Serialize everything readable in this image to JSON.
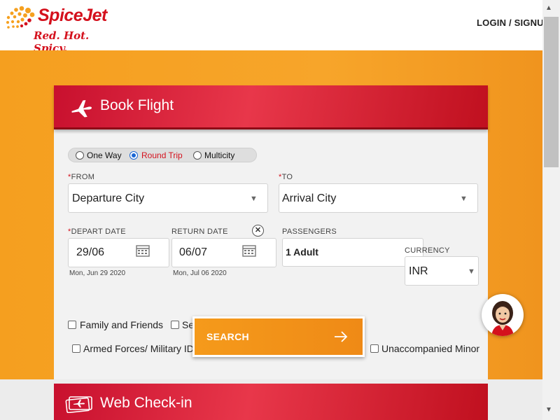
{
  "header": {
    "brand": "SpiceJet",
    "tagline": "Red. Hot. Spicy.",
    "login_signup": "LOGIN / SIGNUP"
  },
  "book_flight": {
    "title": "Book Flight",
    "trip_types": [
      {
        "label": "One Way",
        "selected": false
      },
      {
        "label": "Round Trip",
        "selected": true
      },
      {
        "label": "Multicity",
        "selected": false
      }
    ],
    "from": {
      "label": "FROM",
      "required_mark": "*",
      "value": "Departure City"
    },
    "to": {
      "label": "TO",
      "required_mark": "*",
      "value": "Arrival City"
    },
    "depart_date": {
      "label": "DEPART DATE",
      "required_mark": "*",
      "value": "29/06",
      "sub": "Mon, Jun 29 2020"
    },
    "return_date": {
      "label": "RETURN DATE",
      "value": "06/07",
      "sub": "Mon, Jul 06 2020"
    },
    "passengers": {
      "label": "PASSENGERS",
      "value": "1 Adult"
    },
    "currency": {
      "label": "CURRENCY",
      "value": "INR"
    },
    "options": [
      {
        "label": "Family and Friends",
        "checked": false
      },
      {
        "label": "Se",
        "checked": false
      },
      {
        "label": "Armed Forces/ Military ID",
        "checked": false
      },
      {
        "label": "Unaccompanied Minor",
        "checked": false
      }
    ],
    "search_label": "SEARCH"
  },
  "web_checkin": {
    "title": "Web Check-in"
  },
  "icons": {
    "plane": "plane-icon",
    "calendar": "calendar-icon",
    "clear": "clear-icon",
    "arrow": "arrow-right-icon",
    "ticket": "ticket-icon",
    "caret": "chevron-down-icon"
  },
  "colors": {
    "brand_red": "#d4111d",
    "accent_orange": "#f59f1f"
  }
}
